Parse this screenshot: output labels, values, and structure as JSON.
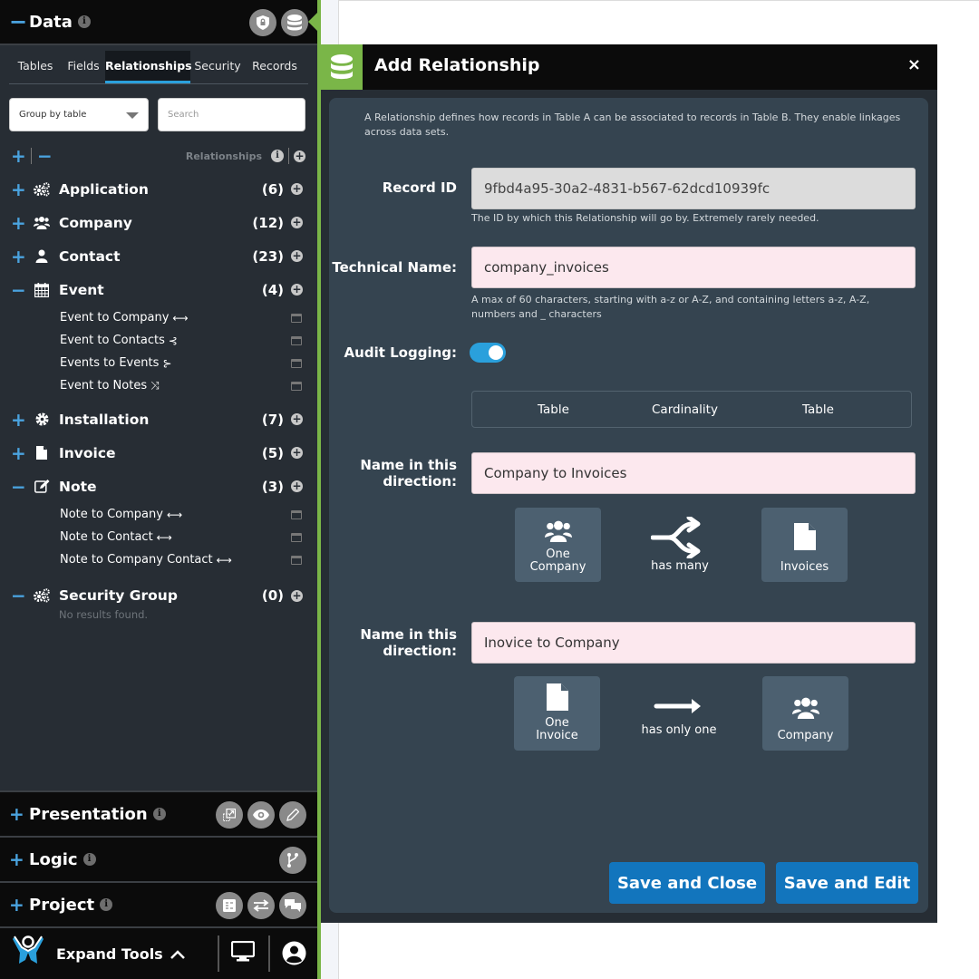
{
  "sidebar": {
    "header": {
      "title": "Data",
      "toggle": "−",
      "info": "i",
      "icons": [
        "shield-lock-icon",
        "database-icon"
      ]
    },
    "tabs": [
      {
        "label": "Tables",
        "active": false
      },
      {
        "label": "Fields",
        "active": false
      },
      {
        "label": "Relationships",
        "active": true
      },
      {
        "label": "Security",
        "active": false
      },
      {
        "label": "Records",
        "active": false
      }
    ],
    "group_select": {
      "value": "Group by table"
    },
    "search": {
      "placeholder": "Search",
      "value": ""
    },
    "tree_controls": {
      "expand": "+",
      "collapse": "−",
      "label": "Relationships",
      "info": "i",
      "add": "+"
    },
    "groups": [
      {
        "name": "Application",
        "count": "(6)",
        "expanded": false,
        "icon": "gears-icon",
        "toggle": "+",
        "children": []
      },
      {
        "name": "Company",
        "count": "(12)",
        "expanded": false,
        "icon": "users-icon",
        "toggle": "+",
        "children": []
      },
      {
        "name": "Contact",
        "count": "(23)",
        "expanded": false,
        "icon": "user-icon",
        "toggle": "+",
        "children": []
      },
      {
        "name": "Event",
        "count": "(4)",
        "expanded": true,
        "icon": "calendar-icon",
        "toggle": "−",
        "children": [
          {
            "label": "Event to Company",
            "glyph": "⟷",
            "type": "one-to-one"
          },
          {
            "label": "Event to Contacts",
            "glyph": "⊰",
            "type": "one-to-many"
          },
          {
            "label": "Events to Events",
            "glyph": "⊱",
            "type": "many-to-one"
          },
          {
            "label": "Event to Notes",
            "glyph": "⤨",
            "type": "many-to-many"
          }
        ]
      },
      {
        "name": "Installation",
        "count": "(7)",
        "expanded": false,
        "icon": "gear-icon",
        "toggle": "+",
        "children": []
      },
      {
        "name": "Invoice",
        "count": "(5)",
        "expanded": false,
        "icon": "file-icon",
        "toggle": "+",
        "children": []
      },
      {
        "name": "Note",
        "count": "(3)",
        "expanded": true,
        "icon": "edit-icon",
        "toggle": "−",
        "children": [
          {
            "label": "Note to Company",
            "glyph": "⟷",
            "type": "one-to-one"
          },
          {
            "label": "Note to Contact",
            "glyph": "⟷",
            "type": "one-to-one"
          },
          {
            "label": "Note to Company Contact",
            "glyph": "⟷",
            "type": "one-to-one"
          }
        ]
      },
      {
        "name": "Security Group",
        "count": "(0)",
        "expanded": true,
        "icon": "gears-icon",
        "toggle": "−",
        "children": [],
        "empty_text": "No results found."
      }
    ],
    "sections": [
      {
        "title": "Presentation",
        "toggle": "+",
        "info": "i",
        "icons": [
          "resize-icon",
          "eye-icon",
          "pencil-icon"
        ]
      },
      {
        "title": "Logic",
        "toggle": "+",
        "info": "i",
        "icons": [
          "branch-icon"
        ]
      },
      {
        "title": "Project",
        "toggle": "+",
        "info": "i",
        "icons": [
          "checklist-icon",
          "swap-icon",
          "chat-icon"
        ]
      }
    ],
    "bottom": {
      "label": "Expand Tools",
      "icons": [
        "logo-icon",
        "chevron-up-icon",
        "monitor-icon",
        "user-circle-icon"
      ]
    }
  },
  "modal": {
    "title": "Add Relationship",
    "close": "×",
    "intro": "A Relationship defines how records in Table A can be associated to records in Table B. They enable linkages across data sets.",
    "record_id": {
      "label": "Record ID",
      "value": "9fbd4a95-30a2-4831-b567-62dcd10939fc",
      "help": "The ID by which this Relationship will go by. Extremely rarely needed."
    },
    "technical_name": {
      "label": "Technical Name:",
      "value": "company_invoices",
      "help": "A max of 60 characters, starting with a-z or A-Z, and containing letters a-z, A-Z, numbers and _ characters"
    },
    "audit_logging": {
      "label": "Audit Logging:",
      "enabled": true
    },
    "card_headers": [
      "Table",
      "Cardinality",
      "Table"
    ],
    "direction_1": {
      "label": "Name in this direction:",
      "value": "Company to Invoices",
      "left_tile": {
        "line1": "One",
        "line2": "Company",
        "icon": "users-icon"
      },
      "cardinality": "has many",
      "cardinality_icon": "split-arrow-icon",
      "right_tile": {
        "line1": "Invoices",
        "icon": "file-icon"
      }
    },
    "direction_2": {
      "label": "Name in this direction:",
      "value": "Inovice to Company",
      "left_tile": {
        "line1": "One",
        "line2": "Invoice",
        "icon": "file-icon"
      },
      "cardinality": "has only one",
      "cardinality_icon": "arrow-right-icon",
      "right_tile": {
        "line1": "Company",
        "icon": "users-icon"
      }
    },
    "buttons": {
      "save_close": "Save and Close",
      "save_edit": "Save and Edit"
    }
  },
  "colors": {
    "accent_green": "#7ab648",
    "accent_blue": "#2aa0dc",
    "button_blue": "#1275bd",
    "sidebar_bg": "#272d34",
    "modal_panel": "#354450",
    "input_pink": "#fce8ee"
  }
}
